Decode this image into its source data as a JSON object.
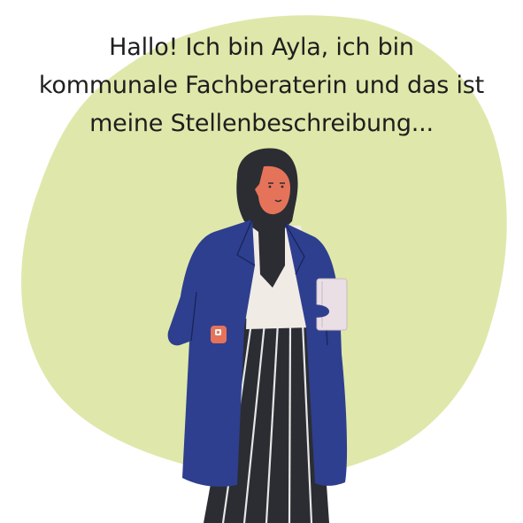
{
  "caption": {
    "line1": "Hallo! Ich bin Ayla, ich bin",
    "line2": "kommunale Fachberaterin und das ist",
    "line3": "meine Stellenbeschreibung..."
  },
  "colors": {
    "background": "#ffffff",
    "blob": "#dfe8aa",
    "coat": "#2e3f8f",
    "scarf": "#2b2d33",
    "skin": "#e5735a",
    "top": "#f1ebe6",
    "trousers": "#2b2d33",
    "stripes": "#e6e6e6",
    "folder": "#eadfe5"
  },
  "icons": [
    "woman-with-folder-illustration"
  ]
}
